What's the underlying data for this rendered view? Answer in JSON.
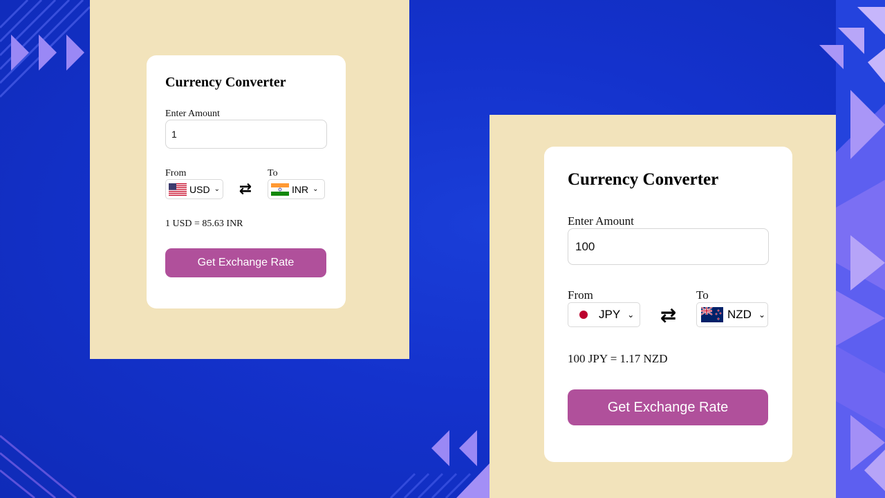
{
  "colors": {
    "background": "#1432cc",
    "panel": "#f2e3bb",
    "card": "#ffffff",
    "button": "#b0509b",
    "decor_purple": "#8f6cf0"
  },
  "converters": {
    "small": {
      "title": "Currency Converter",
      "amount_label": "Enter Amount",
      "amount_value": "1",
      "from_label": "From",
      "from_currency": "USD",
      "from_flag_icon": "us-flag-icon",
      "to_label": "To",
      "to_currency": "INR",
      "to_flag_icon": "india-flag-icon",
      "swap_icon": "swap-arrows-icon",
      "result": "1 USD = 85.63 INR",
      "button_label": "Get Exchange Rate"
    },
    "large": {
      "title": "Currency Converter",
      "amount_label": "Enter Amount",
      "amount_value": "100",
      "from_label": "From",
      "from_currency": "JPY",
      "from_flag_icon": "japan-flag-icon",
      "to_label": "To",
      "to_currency": "NZD",
      "to_flag_icon": "new-zealand-flag-icon",
      "swap_icon": "swap-arrows-icon",
      "result": "100 JPY = 1.17 NZD",
      "button_label": "Get Exchange Rate"
    }
  }
}
